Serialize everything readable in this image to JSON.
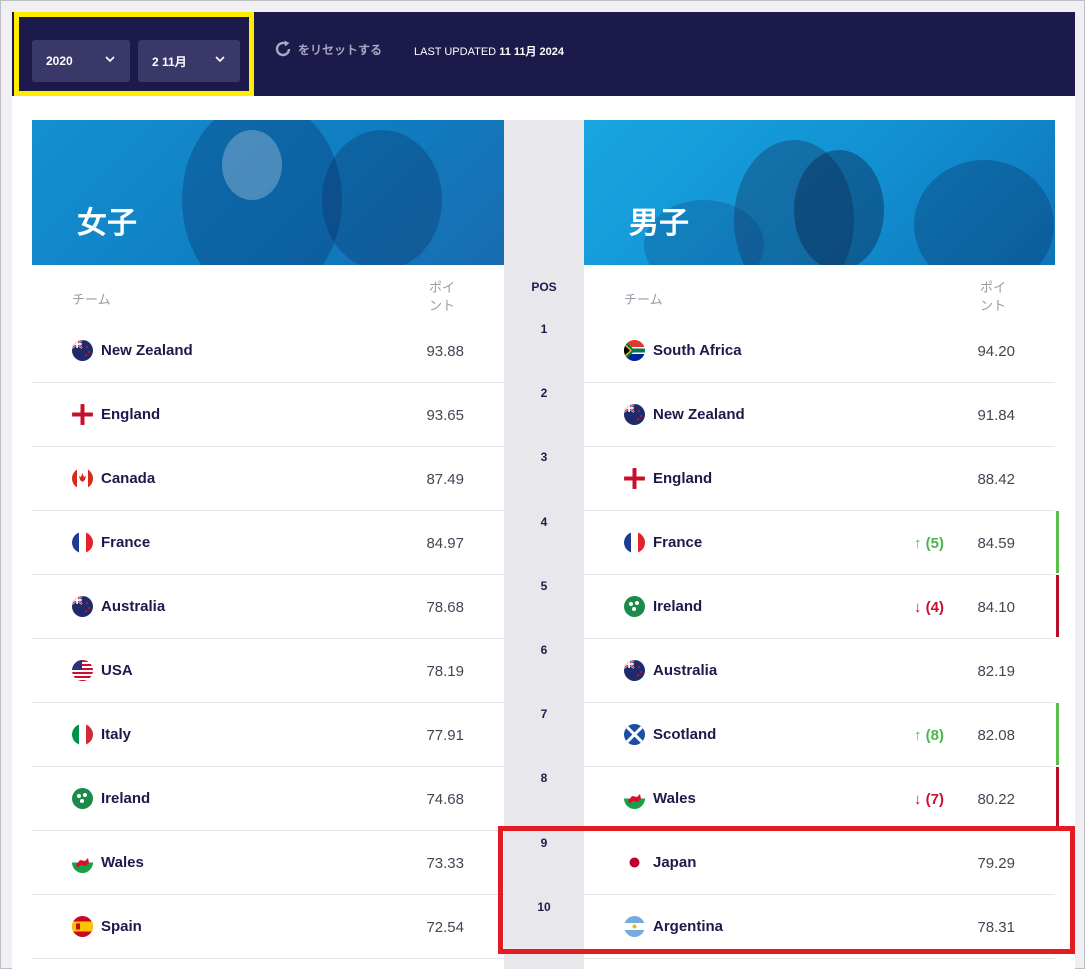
{
  "filters": {
    "year": "2020",
    "date": "2 11月",
    "reset_label": "をリセットする",
    "updated_prefix": "LAST UPDATED",
    "updated_date": "11 11月 2024"
  },
  "columns": {
    "team": "チーム",
    "points": "ポイ\nント",
    "pos": "POS"
  },
  "women": {
    "title": "女子",
    "rows": [
      {
        "name": "New Zealand",
        "points": "93.88",
        "flag": "new-zealand-flag-icon"
      },
      {
        "name": "England",
        "points": "93.65",
        "flag": "england-flag-icon"
      },
      {
        "name": "Canada",
        "points": "87.49",
        "flag": "canada-flag-icon"
      },
      {
        "name": "France",
        "points": "84.97",
        "flag": "france-flag-icon"
      },
      {
        "name": "Australia",
        "points": "78.68",
        "flag": "australia-flag-icon"
      },
      {
        "name": "USA",
        "points": "78.19",
        "flag": "usa-flag-icon"
      },
      {
        "name": "Italy",
        "points": "77.91",
        "flag": "italy-flag-icon"
      },
      {
        "name": "Ireland",
        "points": "74.68",
        "flag": "ireland-flag-icon"
      },
      {
        "name": "Wales",
        "points": "73.33",
        "flag": "wales-flag-icon"
      },
      {
        "name": "Spain",
        "points": "72.54",
        "flag": "spain-flag-icon"
      }
    ]
  },
  "men": {
    "title": "男子",
    "rows": [
      {
        "name": "South Africa",
        "points": "94.20",
        "move": "",
        "trend": "",
        "flag": "south-africa-flag-icon"
      },
      {
        "name": "New Zealand",
        "points": "91.84",
        "move": "",
        "trend": "",
        "flag": "new-zealand-flag-icon"
      },
      {
        "name": "England",
        "points": "88.42",
        "move": "",
        "trend": "",
        "flag": "england-flag-icon"
      },
      {
        "name": "France",
        "points": "84.59",
        "move": "↑ (5)",
        "trend": "up",
        "flag": "france-flag-icon"
      },
      {
        "name": "Ireland",
        "points": "84.10",
        "move": "↓ (4)",
        "trend": "down",
        "flag": "ireland-flag-icon"
      },
      {
        "name": "Australia",
        "points": "82.19",
        "move": "",
        "trend": "",
        "flag": "australia-flag-icon"
      },
      {
        "name": "Scotland",
        "points": "82.08",
        "move": "↑ (8)",
        "trend": "up",
        "flag": "scotland-flag-icon"
      },
      {
        "name": "Wales",
        "points": "80.22",
        "move": "↓ (7)",
        "trend": "down",
        "flag": "wales-flag-icon"
      },
      {
        "name": "Japan",
        "points": "79.29",
        "move": "",
        "trend": "",
        "flag": "japan-flag-icon"
      },
      {
        "name": "Argentina",
        "points": "78.31",
        "move": "",
        "trend": "",
        "flag": "argentina-flag-icon"
      }
    ]
  },
  "positions": [
    "1",
    "2",
    "3",
    "4",
    "5",
    "6",
    "7",
    "8",
    "9",
    "10"
  ],
  "colors": {
    "navy": "#1c1a4b",
    "highlight_yellow": "#ffed00",
    "highlight_red": "#e51b23",
    "up": "#49b64a",
    "down": "#c8102e"
  }
}
